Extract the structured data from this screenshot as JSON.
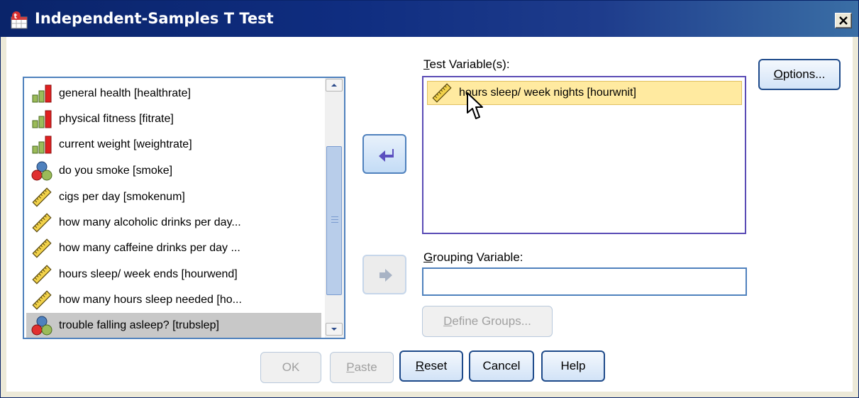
{
  "window": {
    "title": "Independent-Samples T Test",
    "close_label": "X"
  },
  "source_list": {
    "items": [
      {
        "label": "general health [healthrate]",
        "icon": "ordinal-icon"
      },
      {
        "label": "physical fitness [fitrate]",
        "icon": "ordinal-icon"
      },
      {
        "label": "current weight [weightrate]",
        "icon": "ordinal-icon"
      },
      {
        "label": "do you smoke [smoke]",
        "icon": "nominal-icon"
      },
      {
        "label": "cigs per day  [smokenum]",
        "icon": "scale-ruler-icon"
      },
      {
        "label": "how  many alcoholic drinks per day...",
        "icon": "scale-ruler-icon"
      },
      {
        "label": "how many caffeine drinks per day ...",
        "icon": "scale-ruler-icon"
      },
      {
        "label": "hours sleep/ week ends [hourwend]",
        "icon": "scale-ruler-icon"
      },
      {
        "label": "how many hours sleep needed [ho...",
        "icon": "scale-ruler-icon"
      },
      {
        "label": "trouble falling asleep? [trubslep]",
        "icon": "nominal-icon",
        "selected": true
      }
    ]
  },
  "test_variables": {
    "label_prefix": "T",
    "label_rest": "est Variable(s):",
    "items": [
      {
        "label": "hours sleep/ week nights [hourwnit]",
        "icon": "scale-ruler-icon"
      }
    ]
  },
  "grouping": {
    "label_prefix": "G",
    "label_rest": "rouping Variable:",
    "value": ""
  },
  "buttons": {
    "options_prefix": "O",
    "options_rest": "ptions...",
    "define_prefix": "D",
    "define_rest": "efine Groups...",
    "ok": "OK",
    "paste_prefix": "P",
    "paste_rest": "aste",
    "reset_prefix": "R",
    "reset_rest": "eset",
    "cancel": "Cancel",
    "help": "Help"
  },
  "colors": {
    "titlebar": "#0a246a",
    "selection": "#c8c8c8",
    "test_item_highlight": "#ffeaa0",
    "focus_border": "#4f81bd"
  }
}
